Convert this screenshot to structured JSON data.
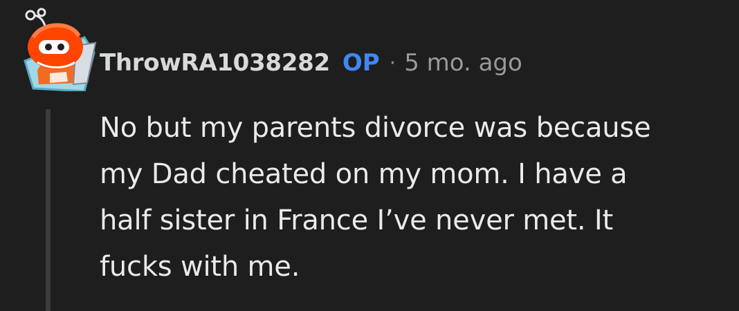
{
  "comment": {
    "username": "ThrowRA1038282",
    "op_badge": "OP",
    "separator": "·",
    "timestamp": "5 mo. ago",
    "avatar_icon": "snoo-avatar-icon",
    "body_lines": [
      "No but my parents divorce was because",
      "my Dad cheated on my mom. I have a",
      "half sister in France I’ve never met. It",
      "fucks with me."
    ]
  },
  "colors": {
    "background": "#1e1e1e",
    "username": "#d7dadc",
    "op_badge": "#3f88f2",
    "meta": "#9a9a9a",
    "body": "#e8eaeb",
    "thread_line": "#3c3c3c",
    "avatar_red": "#ff4500",
    "avatar_orange": "#f26c1f"
  }
}
